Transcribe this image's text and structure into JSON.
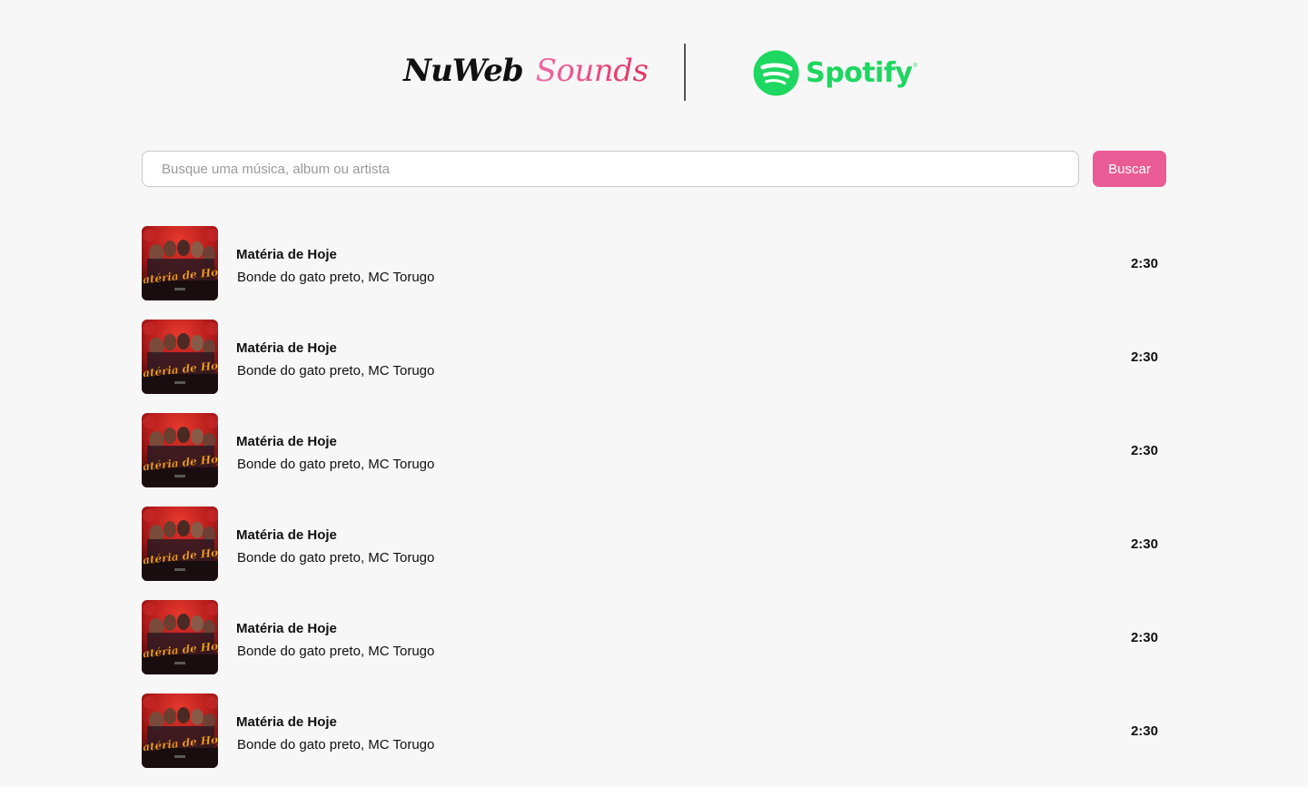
{
  "brand": {
    "part1": "NuWeb",
    "part2": "Sounds"
  },
  "partner": {
    "name": "Spotify",
    "mark": "®",
    "color": "#1ed760"
  },
  "search": {
    "placeholder": "Busque uma música, album ou artista",
    "value": "",
    "button_label": "Buscar",
    "button_color": "#ea5c95"
  },
  "tracks": [
    {
      "title": "Matéria de Hoje",
      "artists": "Bonde do gato preto, MC Torugo",
      "duration": "2:30",
      "cover_text": "Matéria de Hoje"
    },
    {
      "title": "Matéria de Hoje",
      "artists": "Bonde do gato preto, MC Torugo",
      "duration": "2:30",
      "cover_text": "Matéria de Hoje"
    },
    {
      "title": "Matéria de Hoje",
      "artists": "Bonde do gato preto, MC Torugo",
      "duration": "2:30",
      "cover_text": "Matéria de Hoje"
    },
    {
      "title": "Matéria de Hoje",
      "artists": "Bonde do gato preto, MC Torugo",
      "duration": "2:30",
      "cover_text": "Matéria de Hoje"
    },
    {
      "title": "Matéria de Hoje",
      "artists": "Bonde do gato preto, MC Torugo",
      "duration": "2:30",
      "cover_text": "Matéria de Hoje"
    },
    {
      "title": "Matéria de Hoje",
      "artists": "Bonde do gato preto, MC Torugo",
      "duration": "2:30",
      "cover_text": "Matéria de Hoje"
    }
  ]
}
